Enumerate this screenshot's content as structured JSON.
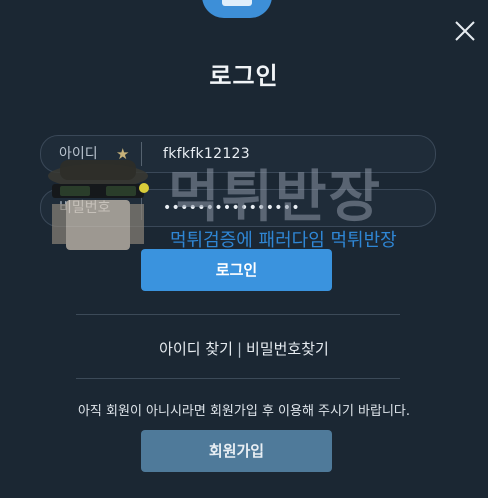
{
  "header": {
    "title": "로그인",
    "close_icon": "close-icon"
  },
  "form": {
    "id_label": "아이디",
    "id_value": "fkfkfk12123",
    "password_label": "비밀번호",
    "password_value": "••••••••••••••••",
    "login_button": "로그인"
  },
  "watermark": {
    "main": "먹튀반장",
    "sub": "먹튀검증에 패러다임 먹튀반장"
  },
  "links": {
    "find_id": "아이디 찾기",
    "separator": "|",
    "find_password": "비밀번호찾기"
  },
  "signup": {
    "notice": "아직 회원이 아니시라면 회원가입 후 이용해 주시기 바랍니다.",
    "button": "회원가입"
  },
  "colors": {
    "background": "#1b2733",
    "accent": "#3a93de",
    "signup_button": "#4f7a9a",
    "watermark_sub": "#2f86d4"
  }
}
